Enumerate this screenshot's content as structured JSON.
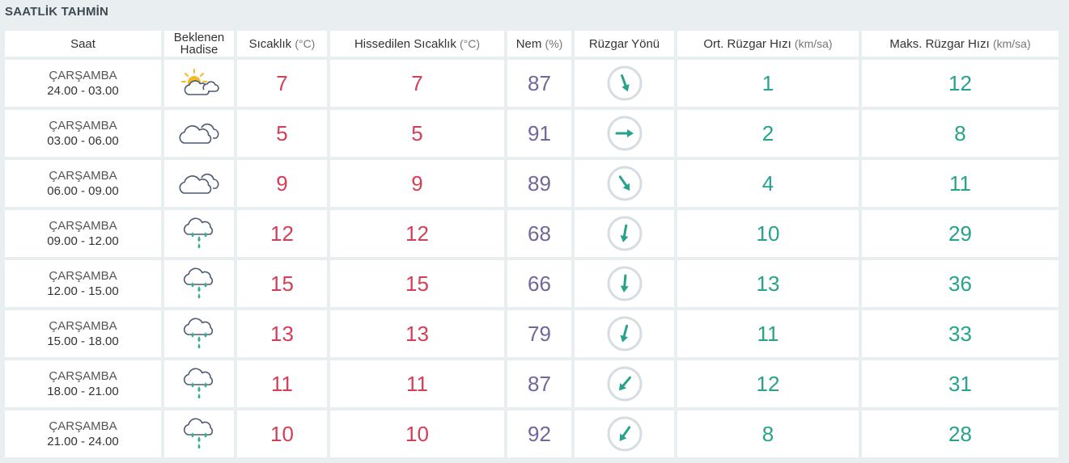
{
  "section_title": "SAATLİK TAHMİN",
  "headers": {
    "saat": "Saat",
    "hadise_line1": "Beklenen",
    "hadise_line2": "Hadise",
    "sicaklik": "Sıcaklık",
    "sicaklik_unit": "(°C)",
    "hissedilen": "Hissedilen Sıcaklık",
    "hissedilen_unit": "(°C)",
    "nem": "Nem",
    "nem_unit": "(%)",
    "ruzgar_yonu": "Rüzgar Yönü",
    "ort_ruzgar": "Ort. Rüzgar Hızı",
    "ort_ruzgar_unit": "(km/sa)",
    "maks_ruzgar": "Maks. Rüzgar Hızı",
    "maks_ruzgar_unit": "(km/sa)"
  },
  "rows": [
    {
      "day": "ÇARŞAMBA",
      "range": "24.00 - 03.00",
      "icon": "partly-cloudy-icon",
      "temp": "7",
      "feel": "7",
      "nem": "87",
      "wind_dir_deg": 160,
      "avg": "1",
      "max": "12"
    },
    {
      "day": "ÇARŞAMBA",
      "range": "03.00 - 06.00",
      "icon": "cloudy-icon",
      "temp": "5",
      "feel": "5",
      "nem": "91",
      "wind_dir_deg": 90,
      "avg": "2",
      "max": "8"
    },
    {
      "day": "ÇARŞAMBA",
      "range": "06.00 - 09.00",
      "icon": "cloudy-icon",
      "temp": "9",
      "feel": "9",
      "nem": "89",
      "wind_dir_deg": 145,
      "avg": "4",
      "max": "11"
    },
    {
      "day": "ÇARŞAMBA",
      "range": "09.00 - 12.00",
      "icon": "rain-icon",
      "temp": "12",
      "feel": "12",
      "nem": "68",
      "wind_dir_deg": 190,
      "avg": "10",
      "max": "29"
    },
    {
      "day": "ÇARŞAMBA",
      "range": "12.00 - 15.00",
      "icon": "rain-icon",
      "temp": "15",
      "feel": "15",
      "nem": "66",
      "wind_dir_deg": 185,
      "avg": "13",
      "max": "36"
    },
    {
      "day": "ÇARŞAMBA",
      "range": "15.00 - 18.00",
      "icon": "rain-icon",
      "temp": "13",
      "feel": "13",
      "nem": "79",
      "wind_dir_deg": 195,
      "avg": "11",
      "max": "33"
    },
    {
      "day": "ÇARŞAMBA",
      "range": "18.00 - 21.00",
      "icon": "rain-icon",
      "temp": "11",
      "feel": "11",
      "nem": "87",
      "wind_dir_deg": 220,
      "avg": "12",
      "max": "31"
    },
    {
      "day": "ÇARŞAMBA",
      "range": "21.00 - 24.00",
      "icon": "rain-icon",
      "temp": "10",
      "feel": "10",
      "nem": "92",
      "wind_dir_deg": 215,
      "avg": "8",
      "max": "28"
    }
  ],
  "colors": {
    "temperature": "#d23f57",
    "humidity": "#74669a",
    "wind": "#27a28b",
    "icon_outline": "#4d5a72",
    "sun": "#f5b924",
    "rain": "#2eb38a"
  }
}
